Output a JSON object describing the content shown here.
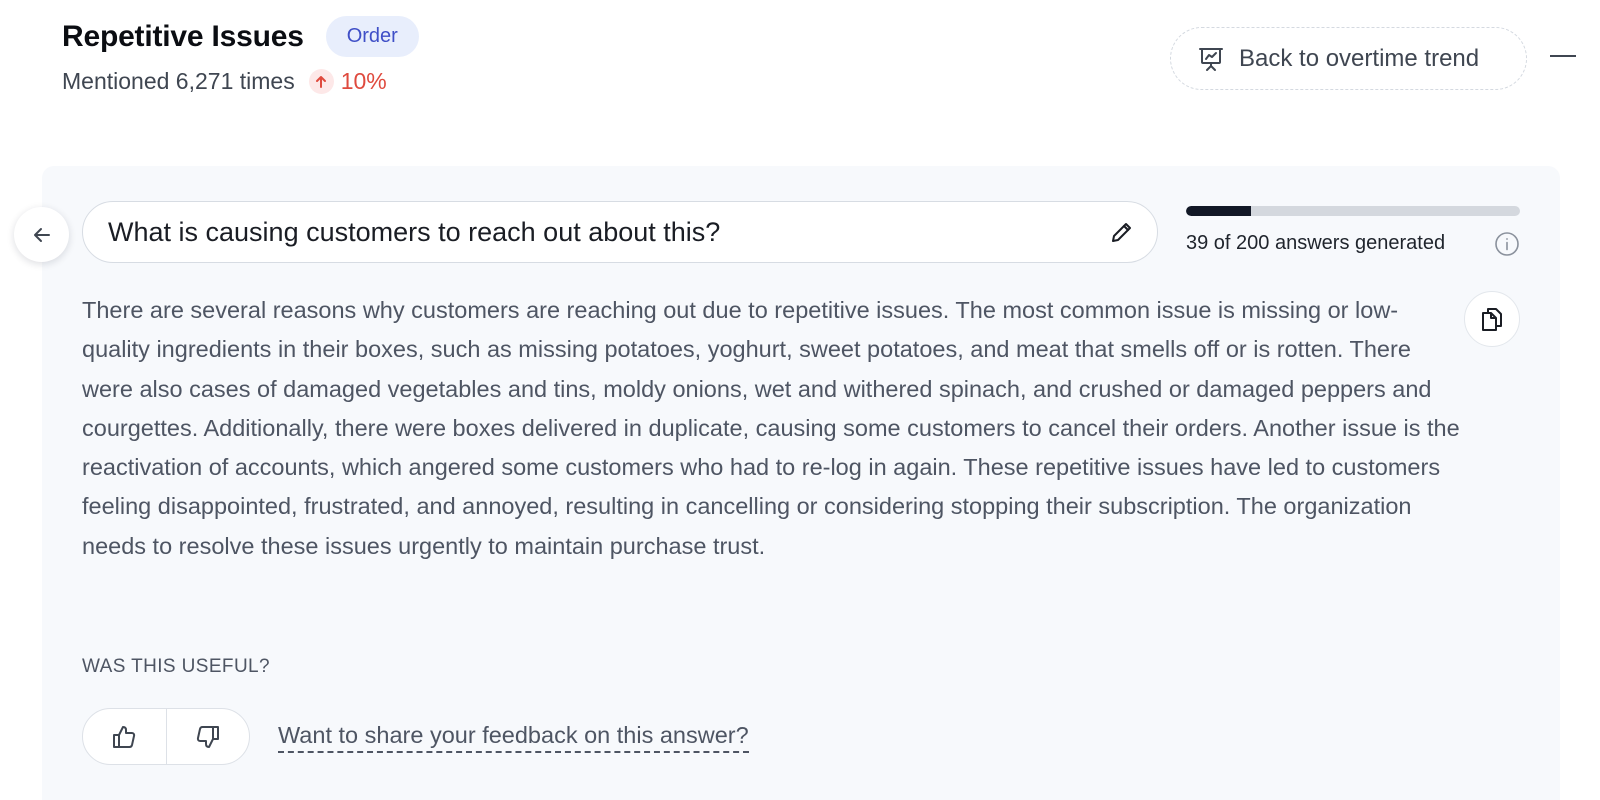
{
  "header": {
    "title": "Repetitive Issues",
    "badge": "Order",
    "mention_text": "Mentioned 6,271 times",
    "trend_direction": "up",
    "trend_value": "10%",
    "trend_color": "#df4a3e",
    "back_button_label": "Back to overtime trend",
    "back_button_icon": "presentation-chart-icon",
    "minimize_icon": "minimize-icon"
  },
  "question": {
    "text": "What is causing customers to reach out about this?",
    "edit_icon": "pencil-icon",
    "back_icon": "arrow-left-icon"
  },
  "progress": {
    "generated": 39,
    "total": 200,
    "label": "39 of 200 answers generated",
    "info_icon": "info-icon"
  },
  "answer": {
    "text": "There are several reasons why customers are reaching out due to repetitive issues. The most common issue is missing or low-quality ingredients in their boxes, such as missing potatoes, yoghurt, sweet potatoes, and meat that smells off or is rotten. There were also cases of damaged vegetables and tins, moldy onions, wet and withered spinach, and crushed or damaged peppers and courgettes. Additionally, there were boxes delivered in duplicate, causing some customers to cancel their orders. Another issue is the reactivation of accounts, which angered some customers who had to re-log in again. These repetitive issues have led to customers feeling disappointed, frustrated, and annoyed, resulting in cancelling or considering stopping their subscription. The organization needs to resolve these issues urgently to maintain purchase trust.",
    "copy_icon": "copy-icon"
  },
  "feedback": {
    "question": "WAS THIS USEFUL?",
    "thumbs_up_icon": "thumbs-up-icon",
    "thumbs_down_icon": "thumbs-down-icon",
    "link_text": "Want to share your feedback on this answer?"
  }
}
